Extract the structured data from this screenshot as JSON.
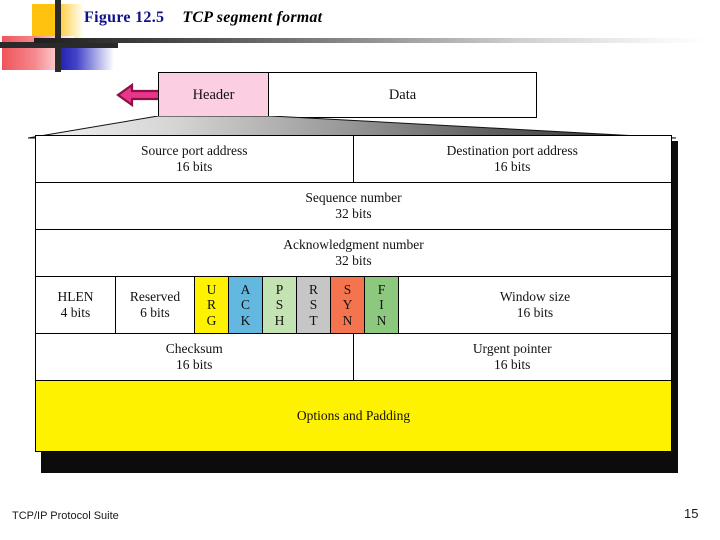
{
  "slide": {
    "figure_number": "Figure 12.5",
    "figure_title": "TCP segment format"
  },
  "packet": {
    "header_label": "Header",
    "data_label": "Data",
    "header_fill": "#FBCEE2",
    "arrow_fill": "#E8368F",
    "arrow_stroke": "#8C1040",
    "arrow_direction": "left"
  },
  "segment": {
    "rows": [
      {
        "cells": [
          {
            "name": "Source port address",
            "bits": "16 bits"
          },
          {
            "name": "Destination port address",
            "bits": "16 bits"
          }
        ]
      },
      {
        "cells": [
          {
            "name": "Sequence number",
            "bits": "32 bits"
          }
        ]
      },
      {
        "cells": [
          {
            "name": "Acknowledgment number",
            "bits": "32 bits"
          }
        ]
      },
      {
        "cells": [
          {
            "name": "Checksum",
            "bits": "16 bits"
          },
          {
            "name": "Urgent pointer",
            "bits": "16 bits"
          }
        ]
      }
    ],
    "flags_row": {
      "hlen": {
        "name": "HLEN",
        "bits": "4 bits"
      },
      "reserved": {
        "name": "Reserved",
        "bits": "6 bits"
      },
      "window": {
        "name": "Window size",
        "bits": "16 bits"
      },
      "flags": [
        {
          "label": "URG",
          "letters": [
            "U",
            "R",
            "G"
          ],
          "color": "#FFF200"
        },
        {
          "label": "ACK",
          "letters": [
            "A",
            "C",
            "K"
          ],
          "color": "#63B8E0"
        },
        {
          "label": "PSH",
          "letters": [
            "P",
            "S",
            "H"
          ],
          "color": "#C4E3B2"
        },
        {
          "label": "RST",
          "letters": [
            "R",
            "S",
            "T"
          ],
          "color": "#C6C6C6"
        },
        {
          "label": "SYN",
          "letters": [
            "S",
            "Y",
            "N"
          ],
          "color": "#F4744F"
        },
        {
          "label": "FIN",
          "letters": [
            "F",
            "I",
            "N"
          ],
          "color": "#8CC97E"
        }
      ]
    },
    "options": {
      "label": "Options and Padding",
      "color": "#FFF200"
    }
  },
  "footer": {
    "text": "TCP/IP Protocol Suite",
    "page": "15"
  }
}
